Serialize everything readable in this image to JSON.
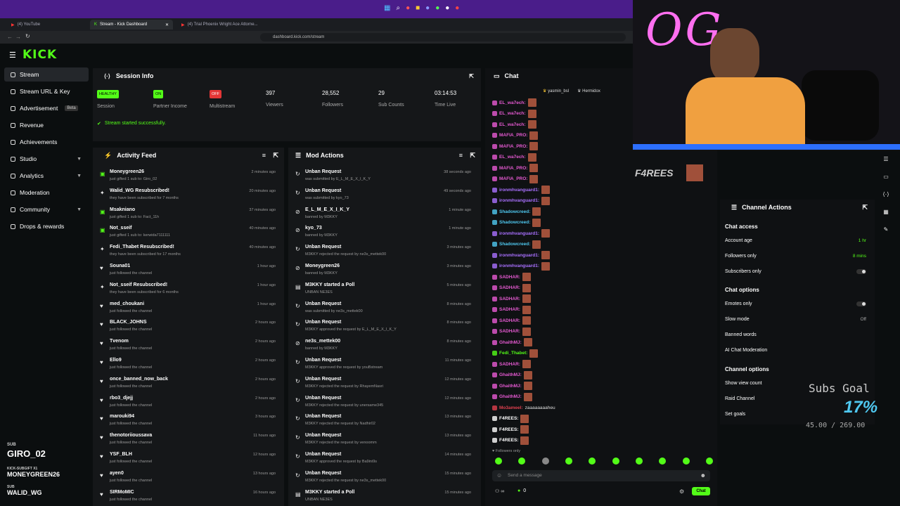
{
  "browser": {
    "tabs": [
      {
        "label": "(4) YouTube"
      },
      {
        "label": "Stream - Kick Dashboard"
      },
      {
        "label": "(4) Trial Phoenix Wright Ace Attorne..."
      }
    ],
    "url": "dashboard.kick.com/stream"
  },
  "app": {
    "logo": "KICK"
  },
  "sidebar": {
    "items": [
      {
        "label": "Stream",
        "icon": "stream-icon"
      },
      {
        "label": "Stream URL & Key",
        "icon": "link-icon"
      },
      {
        "label": "Advertisement",
        "badge": "Beta",
        "icon": "ad-icon"
      },
      {
        "label": "Revenue",
        "icon": "revenue-icon"
      },
      {
        "label": "Achievements",
        "icon": "trophy-icon"
      },
      {
        "label": "Studio",
        "icon": "studio-icon"
      },
      {
        "label": "Analytics",
        "icon": "analytics-icon"
      },
      {
        "label": "Moderation",
        "icon": "shield-icon"
      },
      {
        "label": "Community",
        "icon": "community-icon"
      },
      {
        "label": "Drops & rewards",
        "icon": "gift-icon"
      }
    ]
  },
  "session": {
    "title": "Session Info",
    "status_healthy": "HEALTHY",
    "status_on": "ON",
    "status_off": "OFF",
    "session_label": "Session",
    "partner_label": "Partner Income",
    "multistream_label": "Multistream",
    "viewers": "397",
    "viewers_label": "Viewers",
    "followers": "28,552",
    "followers_label": "Followers",
    "subs": "29",
    "subs_label": "Sub Counts",
    "time": "03:14:53",
    "time_label": "Time Live",
    "message": "Stream started successfully."
  },
  "activity": {
    "title": "Activity Feed",
    "items": [
      {
        "name": "Moneygreen26",
        "sub": "just gifted 1 sub to: Giro_02",
        "time": "2 minutes ago",
        "icon": "gift"
      },
      {
        "name": "Walid_WG Resubscribed!",
        "sub": "they have been subscribed for 7 months",
        "time": "20 minutes ago",
        "icon": "star"
      },
      {
        "name": "Msakniano",
        "sub": "just gifted 1 sub to: Fact_11h",
        "time": "37 minutes ago",
        "icon": "gift"
      },
      {
        "name": "Not_sseif",
        "sub": "just gifted 1 sub to: kerwida7111111",
        "time": "40 minutes ago",
        "icon": "gift"
      },
      {
        "name": "Fedi_Thabet Resubscribed!",
        "sub": "they have been subscribed for 17 months",
        "time": "40 minutes ago",
        "icon": "star"
      },
      {
        "name": "Souna01",
        "sub": "just followed the channel",
        "time": "1 hour ago",
        "icon": "heart"
      },
      {
        "name": "Not_sseif Resubscribed!",
        "sub": "they have been subscribed for 6 months",
        "time": "1 hour ago",
        "icon": "star"
      },
      {
        "name": "med_choukani",
        "sub": "just followed the channel",
        "time": "1 hour ago",
        "icon": "heart"
      },
      {
        "name": "BLACK_JOHNS",
        "sub": "just followed the channel",
        "time": "2 hours ago",
        "icon": "heart"
      },
      {
        "name": "Tvenom",
        "sub": "just followed the channel",
        "time": "2 hours ago",
        "icon": "heart"
      },
      {
        "name": "Ello9",
        "sub": "just followed the channel",
        "time": "2 hours ago",
        "icon": "heart"
      },
      {
        "name": "once_banned_now_back",
        "sub": "just followed the channel",
        "time": "2 hours ago",
        "icon": "heart"
      },
      {
        "name": "rbo3_djejj",
        "sub": "just followed the channel",
        "time": "2 hours ago",
        "icon": "heart"
      },
      {
        "name": "marouki94",
        "sub": "just followed the channel",
        "time": "3 hours ago",
        "icon": "heart"
      },
      {
        "name": "thenotoriioussava",
        "sub": "just followed the channel",
        "time": "11 hours ago",
        "icon": "heart"
      },
      {
        "name": "YSF_BLH",
        "sub": "just followed the channel",
        "time": "12 hours ago",
        "icon": "heart"
      },
      {
        "name": "ayen0",
        "sub": "just followed the channel",
        "time": "13 hours ago",
        "icon": "heart"
      },
      {
        "name": "SIRMoMIC",
        "sub": "just followed the channel",
        "time": "16 hours ago",
        "icon": "heart"
      }
    ]
  },
  "mod": {
    "title": "Mod Actions",
    "items": [
      {
        "name": "Unban Request",
        "sub": "was submitted by E_L_M_E_X_I_K_Y",
        "time": "38 seconds ago",
        "icon": "unban"
      },
      {
        "name": "Unban Request",
        "sub": "was submitted by kyo_73",
        "time": "49 seconds ago",
        "icon": "unban"
      },
      {
        "name": "E_L_M_E_X_I_K_Y",
        "sub": "banned by M3KKY",
        "time": "1 minute ago",
        "icon": "ban"
      },
      {
        "name": "kyo_73",
        "sub": "banned by M3KKY",
        "time": "1 minute ago",
        "icon": "ban"
      },
      {
        "name": "Unban Request",
        "sub": "M3KKY rejected the request by ne3s_mettek00",
        "time": "3 minutes ago",
        "icon": "unban"
      },
      {
        "name": "Moneygreen26",
        "sub": "banned by M3KKY",
        "time": "3 minutes ago",
        "icon": "ban"
      },
      {
        "name": "M3KKY started a Poll",
        "sub": "UNBAN NE3ES",
        "time": "5 minutes ago",
        "icon": "poll"
      },
      {
        "name": "Unban Request",
        "sub": "was submitted by ne3s_mettek00",
        "time": "8 minutes ago",
        "icon": "unban"
      },
      {
        "name": "Unban Request",
        "sub": "M3KKY approved the request by E_L_M_E_X_I_K_Y",
        "time": "8 minutes ago",
        "icon": "unban"
      },
      {
        "name": "ne3s_mettek00",
        "sub": "banned by M3KKY",
        "time": "8 minutes ago",
        "icon": "ban"
      },
      {
        "name": "Unban Request",
        "sub": "M3KKY approved the request by youBstream",
        "time": "11 minutes ago",
        "icon": "unban"
      },
      {
        "name": "Unban Request",
        "sub": "M3KKY rejected the request by RhayemNasri",
        "time": "12 minutes ago",
        "icon": "unban"
      },
      {
        "name": "Unban Request",
        "sub": "M3KKY rejected the request by unersame345",
        "time": "12 minutes ago",
        "icon": "unban"
      },
      {
        "name": "Unban Request",
        "sub": "M3KKY rejected the request by Nadhir02",
        "time": "13 minutes ago",
        "icon": "unban"
      },
      {
        "name": "Unban Request",
        "sub": "M3KKY rejected the request by venoomm",
        "time": "13 minutes ago",
        "icon": "unban"
      },
      {
        "name": "Unban Request",
        "sub": "M3KKY approved the request by Ba9ini9s",
        "time": "14 minutes ago",
        "icon": "unban"
      },
      {
        "name": "Unban Request",
        "sub": "M3KKY rejected the request by ne3s_mettek00",
        "time": "15 minutes ago",
        "icon": "unban"
      },
      {
        "name": "M3KKY started a Poll",
        "sub": "UNBAN NE3ES",
        "time": "15 minutes ago",
        "icon": "poll"
      }
    ]
  },
  "chat": {
    "title": "Chat",
    "pinned": [
      "yasmin_bsl",
      "Hermidox"
    ],
    "lines": [
      {
        "name": "EL_wa7ech:",
        "color": "#e75ad3"
      },
      {
        "name": "EL_wa7ech:",
        "color": "#e75ad3"
      },
      {
        "name": "EL_wa7ech:",
        "color": "#e75ad3"
      },
      {
        "name": "MAFIA_PRO:",
        "color": "#e75ad3"
      },
      {
        "name": "MAFIA_PRO:",
        "color": "#e75ad3"
      },
      {
        "name": "EL_wa7ech:",
        "color": "#e75ad3"
      },
      {
        "name": "MAFIA_PRO:",
        "color": "#e75ad3"
      },
      {
        "name": "MAFIA_PRO:",
        "color": "#e75ad3"
      },
      {
        "name": "ironmhvanguard1:",
        "color": "#a970ff"
      },
      {
        "name": "ironmhvanguard1:",
        "color": "#a970ff"
      },
      {
        "name": "Shadowcreed:",
        "color": "#4fc8f0"
      },
      {
        "name": "Shadowcreed:",
        "color": "#4fc8f0"
      },
      {
        "name": "ironmhvanguard1:",
        "color": "#a970ff"
      },
      {
        "name": "Shadowcreed:",
        "color": "#4fc8f0"
      },
      {
        "name": "ironmhvanguard1:",
        "color": "#a970ff"
      },
      {
        "name": "ironmhvanguard1:",
        "color": "#a970ff"
      },
      {
        "name": "SADHAR:",
        "color": "#e75ad3"
      },
      {
        "name": "SADHAR:",
        "color": "#e75ad3"
      },
      {
        "name": "SADHAR:",
        "color": "#e75ad3"
      },
      {
        "name": "SADHAR:",
        "color": "#e75ad3"
      },
      {
        "name": "SADHAR:",
        "color": "#e75ad3"
      },
      {
        "name": "SADHAR:",
        "color": "#e75ad3"
      },
      {
        "name": "GhaithMJ:",
        "color": "#e75ad3"
      },
      {
        "name": "Fedi_Thabet:",
        "color": "#53fc18"
      },
      {
        "name": "SADHAR:",
        "color": "#e75ad3"
      },
      {
        "name": "GhaithMJ:",
        "color": "#e75ad3"
      },
      {
        "name": "GhaithMJ:",
        "color": "#e75ad3"
      },
      {
        "name": "GhaithMJ:",
        "color": "#e75ad3"
      },
      {
        "name": "Mo3ameel:",
        "color": "#e0404f",
        "text": "zaaaaaaaahеu"
      },
      {
        "name": "F4REES:",
        "color": "#ffffff"
      },
      {
        "name": "F4REES:",
        "color": "#ffffff"
      },
      {
        "name": "F4REES:",
        "color": "#ffffff"
      }
    ],
    "followers_only": "Followers only",
    "placeholder": "Send a message",
    "count": "0",
    "send_label": "Chat"
  },
  "actions": {
    "title": "Channel Actions",
    "chat_access": "Chat access",
    "account_age": "Account age",
    "account_age_val": "1 hr",
    "followers_only": "Followers only",
    "followers_only_val": "8 mins",
    "subscribers_only": "Subscribers only",
    "chat_options": "Chat options",
    "emotes_only": "Emotes only",
    "slow_mode": "Slow mode",
    "slow_mode_val": "Off",
    "banned_words": "Banned words",
    "ai_mod": "AI Chat Moderation",
    "channel_options": "Channel options",
    "show_view_count": "Show view count",
    "raid_channel": "Raid Channel",
    "set_goals": "Set goals"
  },
  "overlay": {
    "goal_title": "Subs Goal",
    "goal_percent": "17%",
    "goal_progress": "45.00 / 269.00",
    "f4rees": "F4REES",
    "sub_label": "SUB",
    "sub_name": "GIRO_02",
    "gift_label": "KICK-SUBGIFT X1",
    "gift_name": "MONEYGREEN26",
    "sub2_label": "SUB",
    "sub2_name": "WALID_WG"
  },
  "colors": {
    "accent": "#53fc18",
    "panel": "#151719",
    "bg": "#0b0e0f"
  }
}
